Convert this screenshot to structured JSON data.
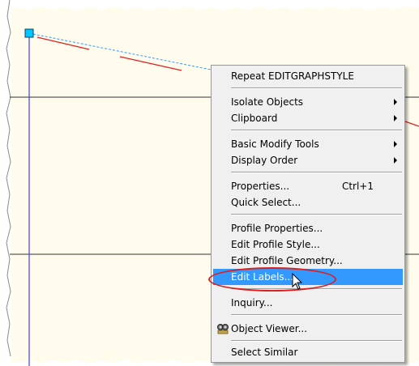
{
  "context_menu": {
    "items": [
      {
        "id": "repeat",
        "label": "Repeat EDITGRAPHSTYLE"
      },
      {
        "id": "isolate",
        "label": "Isolate Objects",
        "submenu": true
      },
      {
        "id": "clipboard",
        "label": "Clipboard",
        "submenu": true
      },
      {
        "id": "basic-modify",
        "label": "Basic Modify Tools",
        "submenu": true
      },
      {
        "id": "display-order",
        "label": "Display Order",
        "submenu": true
      },
      {
        "id": "properties",
        "label": "Properties...",
        "shortcut": "Ctrl+1"
      },
      {
        "id": "quick-select",
        "label": "Quick Select..."
      },
      {
        "id": "profile-properties",
        "label": "Profile Properties..."
      },
      {
        "id": "edit-profile-style",
        "label": "Edit Profile Style..."
      },
      {
        "id": "edit-profile-geometry",
        "label": "Edit Profile Geometry..."
      },
      {
        "id": "edit-labels",
        "label": "Edit Labels...",
        "highlighted": true
      },
      {
        "id": "inquiry",
        "label": "Inquiry..."
      },
      {
        "id": "object-viewer",
        "label": "Object Viewer...",
        "icon": "object-viewer-icon"
      },
      {
        "id": "select-similar",
        "label": "Select Similar"
      }
    ]
  },
  "colors": {
    "canvas_background": "#fffcee",
    "highlight": "#3399ff",
    "annotation": "#d9201f",
    "grip": "#00c8ff",
    "vertical_line": "#4040ff"
  }
}
